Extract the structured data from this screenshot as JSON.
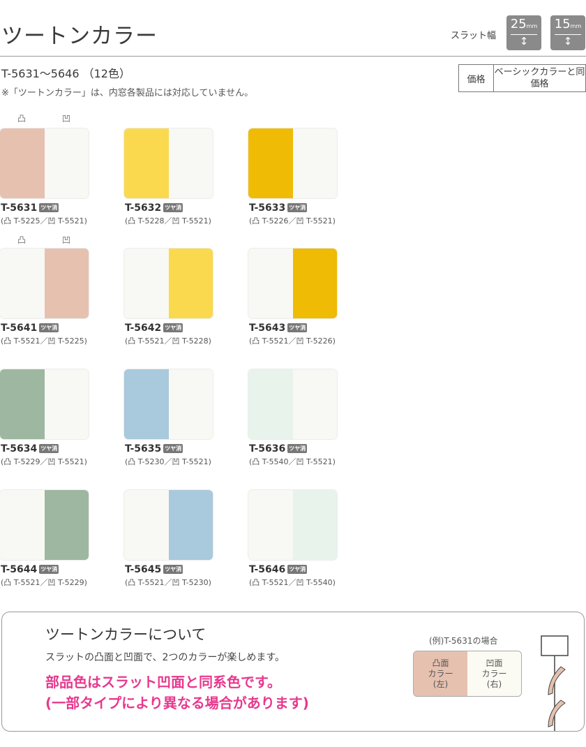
{
  "header": {
    "title": "ツートンカラー",
    "slat_label": "スラット幅",
    "slat_badges": [
      {
        "value": "25",
        "unit": "mm"
      },
      {
        "value": "15",
        "unit": "mm"
      }
    ],
    "arrow_icon": "↕"
  },
  "range": "T-5631～5646 （12色）",
  "note": "※「ツートンカラー」は、内窓各製品には対応していません。",
  "price": {
    "label": "価格",
    "value": "ベーシックカラーと同価格"
  },
  "side_glyphs": {
    "convex": "凸",
    "concave": "凹"
  },
  "gloss_label": "ツヤ消",
  "swatches": [
    {
      "code": "T-5631",
      "sub": "(凸 T-5225／凹 T-5521)",
      "left": "#e6c1b0",
      "right": "#f8f8f4"
    },
    {
      "code": "T-5632",
      "sub": "(凸 T-5228／凹 T-5521)",
      "left": "#fbd94e",
      "right": "#f8f8f4"
    },
    {
      "code": "T-5633",
      "sub": "(凸 T-5226／凹 T-5521)",
      "left": "#efbb05",
      "right": "#f8f8f4"
    },
    {
      "code": "T-5641",
      "sub": "(凸 T-5521／凹 T-5225)",
      "left": "#f8f8f4",
      "right": "#e6c1b0"
    },
    {
      "code": "T-5642",
      "sub": "(凸 T-5521／凹 T-5228)",
      "left": "#f8f8f4",
      "right": "#fbd94e"
    },
    {
      "code": "T-5643",
      "sub": "(凸 T-5521／凹 T-5226)",
      "left": "#f8f8f4",
      "right": "#efbb05"
    },
    {
      "code": "T-5634",
      "sub": "(凸 T-5229／凹 T-5521)",
      "left": "#9eb7a1",
      "right": "#f8f8f4"
    },
    {
      "code": "T-5635",
      "sub": "(凸 T-5230／凹 T-5521)",
      "left": "#a9c9dc",
      "right": "#f8f8f4"
    },
    {
      "code": "T-5636",
      "sub": "(凸 T-5540／凹 T-5521)",
      "left": "#e8f3ec",
      "right": "#f8f8f4"
    },
    {
      "code": "T-5644",
      "sub": "(凸 T-5521／凹 T-5229)",
      "left": "#f8f8f4",
      "right": "#9eb7a1"
    },
    {
      "code": "T-5645",
      "sub": "(凸 T-5521／凹 T-5230)",
      "left": "#f8f8f4",
      "right": "#a9c9dc"
    },
    {
      "code": "T-5646",
      "sub": "(凸 T-5521／凹 T-5540)",
      "left": "#f8f8f4",
      "right": "#e8f3ec"
    }
  ],
  "info": {
    "title": "ツートンカラーについて",
    "body": "スラットの凸面と凹面で、2つのカラーが楽しめます。",
    "highlight_line1": "部品色はスラット凹面と同系色です。",
    "highlight_line2": "(一部タイプにより異なる場合があります)",
    "example_title": "(例)T-5631の場合",
    "example_left": {
      "line1": "凸面",
      "line2": "カラー",
      "line3": "(左)",
      "color": "#e6c1b0"
    },
    "example_right": {
      "line1": "凹面",
      "line2": "カラー",
      "line3": "(右)",
      "color": "#fbfbf3"
    }
  }
}
